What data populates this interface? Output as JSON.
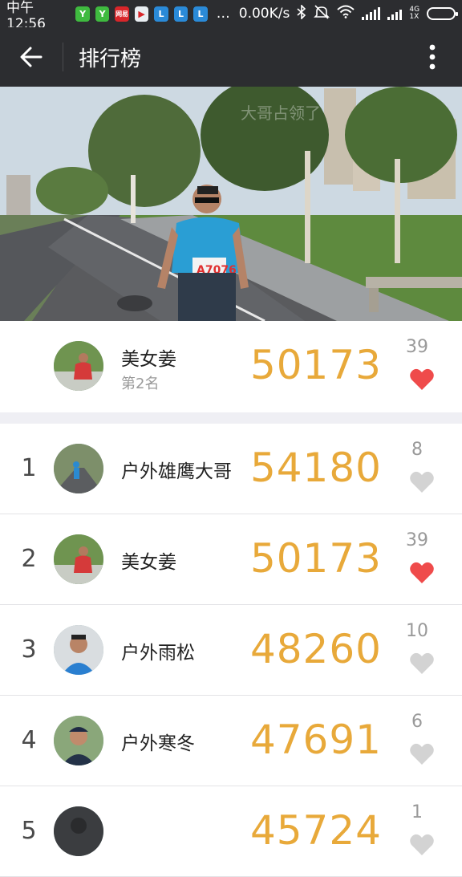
{
  "status_bar": {
    "time": "中午12:56",
    "apps": [
      {
        "icon": "wechat-pay-icon",
        "label": "Y",
        "color": "#3fba3f"
      },
      {
        "icon": "wechat-pay-icon",
        "label": "Y",
        "color": "#3fba3f"
      },
      {
        "icon": "news-app-icon",
        "label": "网易",
        "color": "#d8262a"
      },
      {
        "icon": "video-app-icon",
        "label": "▶",
        "color": "#e9eef2"
      },
      {
        "icon": "app-icon",
        "label": "L",
        "color": "#2a8ad8"
      },
      {
        "icon": "app-icon",
        "label": "L",
        "color": "#2a8ad8"
      },
      {
        "icon": "app-icon",
        "label": "L",
        "color": "#2a8ad8"
      }
    ],
    "more": "…",
    "speed": "0.00K/s",
    "network_label_top": "4G",
    "network_label_bottom": "1X"
  },
  "header": {
    "back_icon": "back-arrow-icon",
    "title": "排行榜",
    "more_icon": "more-vert-icon"
  },
  "banner": {
    "watermark": "大哥占领了",
    "bib": "A7076"
  },
  "my_rank": {
    "name": "美女姜",
    "rank_text": "第2名",
    "steps": "50173",
    "likes": "39",
    "liked": true
  },
  "leaderboard": [
    {
      "rank": "1",
      "name": "户外雄鹰大哥",
      "steps": "54180",
      "likes": "8",
      "liked": false
    },
    {
      "rank": "2",
      "name": "美女姜",
      "steps": "50173",
      "likes": "39",
      "liked": true
    },
    {
      "rank": "3",
      "name": "户外雨松",
      "steps": "48260",
      "likes": "10",
      "liked": false
    },
    {
      "rank": "4",
      "name": "户外寒冬",
      "steps": "47691",
      "likes": "6",
      "liked": false
    },
    {
      "rank": "5",
      "name": "",
      "steps": "45724",
      "likes": "1",
      "liked": false
    }
  ],
  "colors": {
    "accent_steps": "#e8a93a",
    "liked_heart": "#ef4b4b",
    "unliked_heart": "#d3d3d3",
    "header_bg": "#2c2d30"
  }
}
